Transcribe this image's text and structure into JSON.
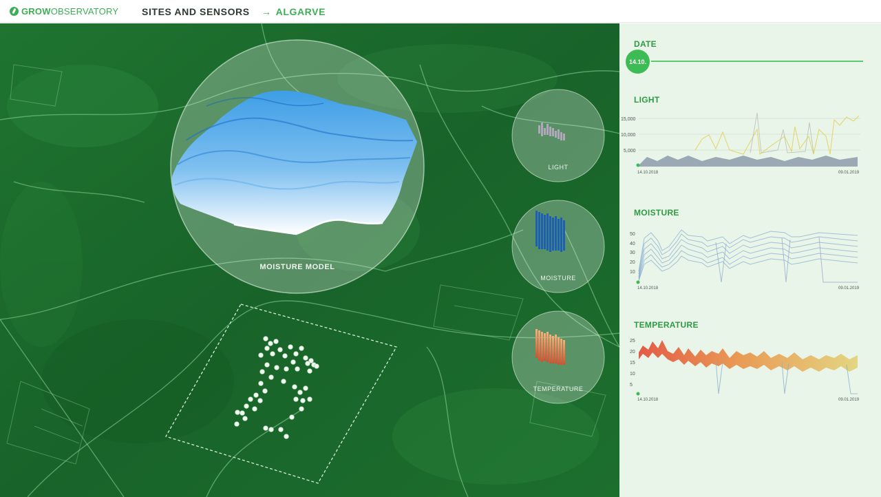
{
  "header": {
    "logo_bold": "GROW",
    "logo_light": "OBSERVATORY",
    "title": "SITES AND SENSORS",
    "crumb_arrow": "→",
    "crumb": "ALGARVE"
  },
  "map": {
    "moisture_model_label": "MOISTURE MODEL",
    "bubbles": [
      {
        "label": "LIGHT",
        "color": "#9a8fa6"
      },
      {
        "label": "MOISTURE",
        "color": "#1e5fb6"
      },
      {
        "label": "TEMPERATURE",
        "color": "#e8773c"
      }
    ]
  },
  "panel": {
    "date_title": "DATE",
    "date_value": "14.10.",
    "charts": [
      {
        "title": "LIGHT",
        "yticks": [
          "15,000",
          "10,000",
          "5,000"
        ],
        "x_start": "14.10.2018",
        "x_end": "09.01.2019"
      },
      {
        "title": "MOISTURE",
        "yticks": [
          "50",
          "40",
          "30",
          "20",
          "10"
        ],
        "x_start": "14.10.2018",
        "x_end": "09.01.2019"
      },
      {
        "title": "TEMPERATURE",
        "yticks": [
          "25",
          "20",
          "15",
          "10",
          "5"
        ],
        "x_start": "14.10.2018",
        "x_end": "09.01.2019"
      }
    ]
  },
  "colors": {
    "brand_green": "#3dae55",
    "map_green": "#1b6b2c",
    "panel_bg": "#e9f5e9",
    "moisture_blue": "#1e5fb6",
    "temperature_red": "#e24a2c"
  }
}
